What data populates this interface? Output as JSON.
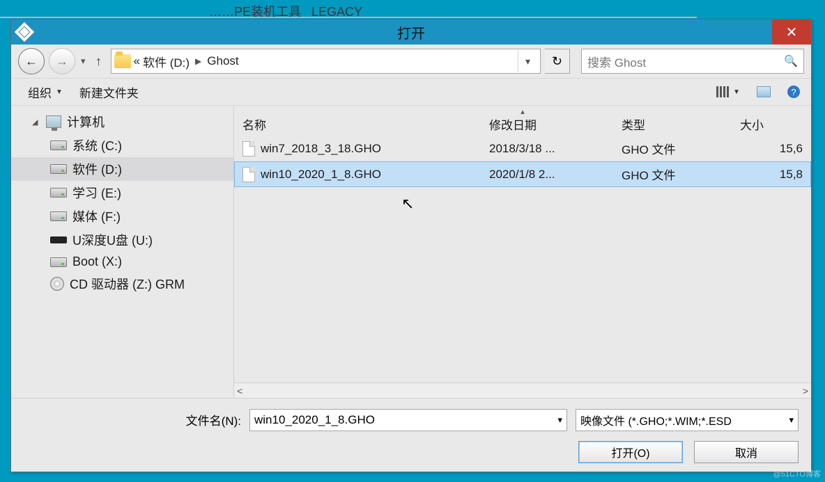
{
  "peek_text": "……PE装机工具   LEGACY",
  "dialog": {
    "title": "打开",
    "breadcrumb": {
      "prefix": "«",
      "seg1": "软件 (D:)",
      "seg2": "Ghost"
    },
    "search_placeholder": "搜索 Ghost",
    "toolbar": {
      "organize": "组织",
      "new_folder": "新建文件夹"
    },
    "columns": {
      "name": "名称",
      "date": "修改日期",
      "type": "类型",
      "size": "大小"
    },
    "tree": {
      "root": "计算机",
      "items": [
        {
          "label": "系统 (C:)",
          "icon": "drive"
        },
        {
          "label": "软件 (D:)",
          "icon": "drive",
          "selected": true
        },
        {
          "label": "学习 (E:)",
          "icon": "drive"
        },
        {
          "label": "媒体 (F:)",
          "icon": "drive"
        },
        {
          "label": "U深度U盘 (U:)",
          "icon": "usb"
        },
        {
          "label": "Boot (X:)",
          "icon": "drive"
        },
        {
          "label": "CD 驱动器 (Z:) GRM",
          "icon": "cd"
        }
      ]
    },
    "files": [
      {
        "name": "win7_2018_3_18.GHO",
        "date": "2018/3/18 ...",
        "type": "GHO 文件",
        "size": "15,6",
        "selected": false
      },
      {
        "name": "win10_2020_1_8.GHO",
        "date": "2020/1/8 2...",
        "type": "GHO 文件",
        "size": "15,8",
        "selected": true
      }
    ],
    "filename_label": "文件名(N):",
    "filename_value": "win10_2020_1_8.GHO",
    "filetype_value": "映像文件 (*.GHO;*.WIM;*.ESD",
    "open_label": "打开(O)",
    "cancel_label": "取消"
  },
  "watermark": "@51CTO博客"
}
